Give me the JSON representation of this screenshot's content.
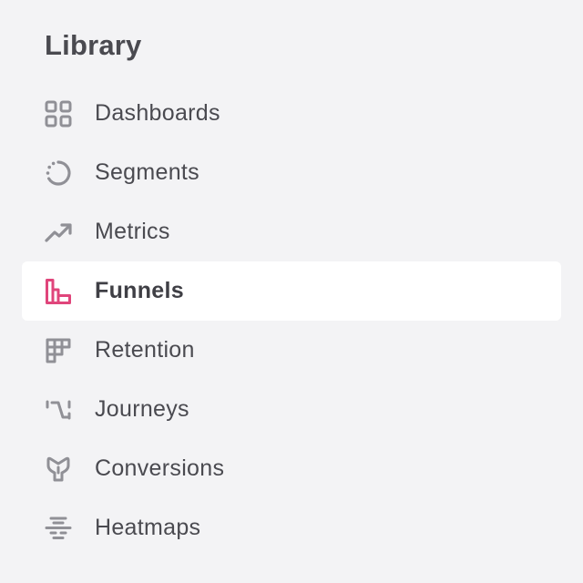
{
  "sidebar": {
    "title": "Library",
    "active_item": "Funnels",
    "colors": {
      "accent": "#e0457b",
      "icon": "#909096",
      "text": "#4a4a50",
      "background": "#f3f3f5",
      "active_background": "#ffffff"
    },
    "items": [
      {
        "label": "Dashboards",
        "icon": "grid-icon"
      },
      {
        "label": "Segments",
        "icon": "segment-circle-icon"
      },
      {
        "label": "Metrics",
        "icon": "trending-up-icon"
      },
      {
        "label": "Funnels",
        "icon": "funnel-bars-icon"
      },
      {
        "label": "Retention",
        "icon": "retention-grid-icon"
      },
      {
        "label": "Journeys",
        "icon": "journey-path-icon"
      },
      {
        "label": "Conversions",
        "icon": "conversion-funnel-icon"
      },
      {
        "label": "Heatmaps",
        "icon": "heatmap-icon"
      }
    ]
  }
}
